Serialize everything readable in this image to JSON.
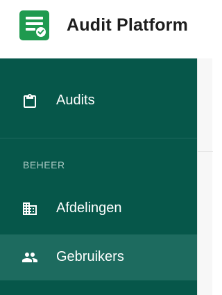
{
  "app": {
    "title": "Audit Platform"
  },
  "sidebar": {
    "items": [
      {
        "label": "Audits",
        "icon": "clipboard-icon"
      }
    ],
    "section": {
      "label": "BEHEER",
      "items": [
        {
          "label": "Afdelingen",
          "icon": "building-icon"
        },
        {
          "label": "Gebruikers",
          "icon": "people-icon",
          "active": true
        }
      ]
    }
  },
  "colors": {
    "sidebar_bg": "#06574a",
    "active_item_bg": "#1d6b5f",
    "logo_bg": "#1f9a4f",
    "section_label": "#a8c8c2"
  }
}
